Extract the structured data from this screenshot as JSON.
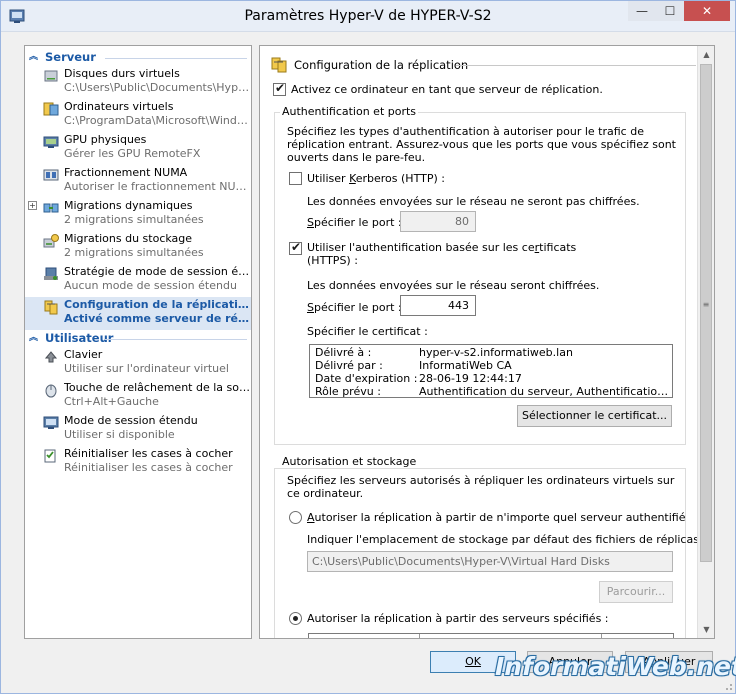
{
  "window": {
    "title": "Paramètres Hyper-V de HYPER-V-S2",
    "min_glyph": "—",
    "max_glyph": "☐",
    "close_glyph": "✕"
  },
  "sidebar": {
    "categories": [
      {
        "label": "Serveur",
        "items": [
          {
            "title": "Disques durs virtuels",
            "subtitle": "C:\\Users\\Public\\Documents\\Hyper-...",
            "icon": "virtual-hard-disk-icon"
          },
          {
            "title": "Ordinateurs virtuels",
            "subtitle": "C:\\ProgramData\\Microsoft\\Windo...",
            "icon": "virtual-machines-icon"
          },
          {
            "title": "GPU physiques",
            "subtitle": "Gérer les GPU RemoteFX",
            "icon": "gpu-icon"
          },
          {
            "title": "Fractionnement NUMA",
            "subtitle": "Autoriser le fractionnement NUMA",
            "icon": "numa-icon"
          },
          {
            "title": "Migrations dynamiques",
            "subtitle": "2 migrations simultanées",
            "icon": "live-migration-icon",
            "expander": "+"
          },
          {
            "title": "Migrations du stockage",
            "subtitle": "2 migrations simultanées",
            "icon": "storage-migration-icon"
          },
          {
            "title": "Stratégie de mode de session étendu",
            "subtitle": "Aucun mode de session étendu",
            "icon": "session-policy-icon"
          },
          {
            "title": "Configuration de la réplication",
            "subtitle": "Activé comme serveur de répl...",
            "icon": "replication-icon",
            "selected": true
          }
        ]
      },
      {
        "label": "Utilisateur",
        "items": [
          {
            "title": "Clavier",
            "subtitle": "Utiliser sur l'ordinateur virtuel",
            "icon": "keyboard-icon"
          },
          {
            "title": "Touche de relâchement de la souris",
            "subtitle": "Ctrl+Alt+Gauche",
            "icon": "mouse-release-icon"
          },
          {
            "title": "Mode de session étendu",
            "subtitle": "Utiliser si disponible",
            "icon": "enhanced-session-icon"
          },
          {
            "title": "Réinitialiser les cases à cocher",
            "subtitle": "Réinitialiser les cases à cocher",
            "icon": "reset-checkboxes-icon"
          }
        ]
      }
    ]
  },
  "main": {
    "section_title": "Configuration de la réplication",
    "enable_checkbox": {
      "label": "Activez ce ordinateur en tant que serveur de réplication.",
      "checked": true
    },
    "auth": {
      "group_label": "Authentification et ports",
      "description": "Spécifiez les types d'authentification à autoriser pour le trafic de réplication entrant. Assurez-vous que les ports que vous spécifiez sont ouverts dans le pare-feu.",
      "kerberos": {
        "label_before": "Utiliser ",
        "label_accel": "K",
        "label_after": "erberos (HTTP) :",
        "checked": false,
        "note": "Les données envoyées sur le réseau ne seront pas chiffrées.",
        "port_label_accel": "S",
        "port_label_rest": "pécifier le port :",
        "port_value": "80"
      },
      "certificate": {
        "label_line1_before": "Utiliser l'authentification basée sur les ce",
        "label_line1_accel": "r",
        "label_line1_after": "tificats",
        "label_line2": "(HTTPS) :",
        "checked": true,
        "note": "Les données envoyées sur le réseau seront chiffrées.",
        "port_label_accel": "S",
        "port_label_rest": "pécifier le port :",
        "port_value": "443",
        "cert_label": "Spécifier le certificat :",
        "cert_rows": [
          {
            "key": "Délivré à :",
            "value": "hyper-v-s2.informatiweb.lan"
          },
          {
            "key": "Délivré par :",
            "value": "InformatiWeb CA"
          },
          {
            "key": "Date d'expiration :",
            "value": "28-06-19 12:44:17"
          },
          {
            "key": "Rôle prévu :",
            "value": "Authentification du serveur, Authentification du c..."
          }
        ],
        "select_button": "Sélectionner le certificat..."
      }
    },
    "authz": {
      "group_label": "Autorisation et stockage",
      "description": "Spécifiez les serveurs autorisés à répliquer les ordinateurs virtuels sur ce ordinateur.",
      "any_server": {
        "label_accel": "A",
        "label_rest": "utoriser la réplication à partir de n'importe quel serveur authentifié",
        "checked": false
      },
      "storage_label": "Indiquer l'emplacement de stockage par défaut des fichiers de réplicas :",
      "storage_value": "C:\\Users\\Public\\Documents\\Hyper-V\\Virtual Hard Disks",
      "browse_button": "Parcourir...",
      "specific_servers": {
        "label": "Autoriser la réplication à partir des serveurs spécifiés :",
        "checked": true
      }
    }
  },
  "footer": {
    "ok": "OK",
    "cancel": "Annuler",
    "apply": "Appliquer"
  },
  "watermark": "InformatiWeb.net"
}
